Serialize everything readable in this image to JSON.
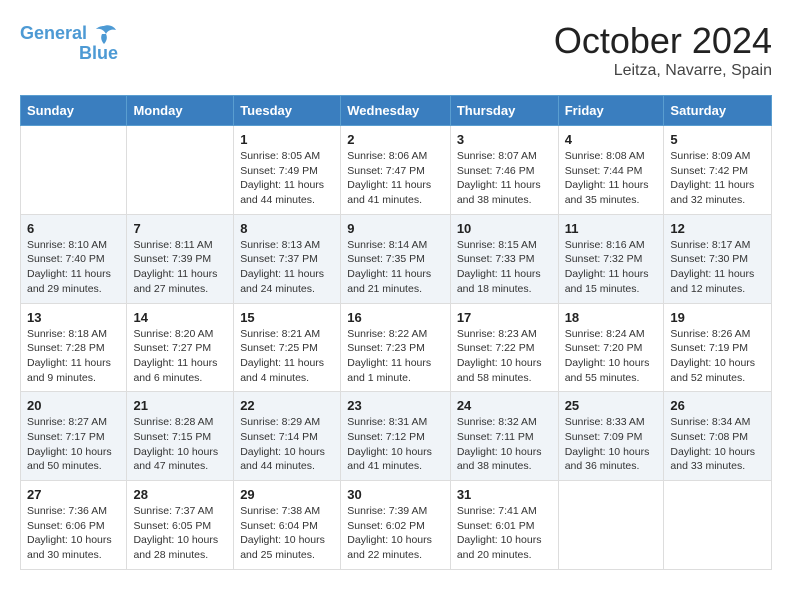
{
  "header": {
    "logo_line1": "General",
    "logo_line2": "Blue",
    "month": "October 2024",
    "location": "Leitza, Navarre, Spain"
  },
  "days_of_week": [
    "Sunday",
    "Monday",
    "Tuesday",
    "Wednesday",
    "Thursday",
    "Friday",
    "Saturday"
  ],
  "weeks": [
    [
      {
        "day": "",
        "info": ""
      },
      {
        "day": "",
        "info": ""
      },
      {
        "day": "1",
        "info": "Sunrise: 8:05 AM\nSunset: 7:49 PM\nDaylight: 11 hours and 44 minutes."
      },
      {
        "day": "2",
        "info": "Sunrise: 8:06 AM\nSunset: 7:47 PM\nDaylight: 11 hours and 41 minutes."
      },
      {
        "day": "3",
        "info": "Sunrise: 8:07 AM\nSunset: 7:46 PM\nDaylight: 11 hours and 38 minutes."
      },
      {
        "day": "4",
        "info": "Sunrise: 8:08 AM\nSunset: 7:44 PM\nDaylight: 11 hours and 35 minutes."
      },
      {
        "day": "5",
        "info": "Sunrise: 8:09 AM\nSunset: 7:42 PM\nDaylight: 11 hours and 32 minutes."
      }
    ],
    [
      {
        "day": "6",
        "info": "Sunrise: 8:10 AM\nSunset: 7:40 PM\nDaylight: 11 hours and 29 minutes."
      },
      {
        "day": "7",
        "info": "Sunrise: 8:11 AM\nSunset: 7:39 PM\nDaylight: 11 hours and 27 minutes."
      },
      {
        "day": "8",
        "info": "Sunrise: 8:13 AM\nSunset: 7:37 PM\nDaylight: 11 hours and 24 minutes."
      },
      {
        "day": "9",
        "info": "Sunrise: 8:14 AM\nSunset: 7:35 PM\nDaylight: 11 hours and 21 minutes."
      },
      {
        "day": "10",
        "info": "Sunrise: 8:15 AM\nSunset: 7:33 PM\nDaylight: 11 hours and 18 minutes."
      },
      {
        "day": "11",
        "info": "Sunrise: 8:16 AM\nSunset: 7:32 PM\nDaylight: 11 hours and 15 minutes."
      },
      {
        "day": "12",
        "info": "Sunrise: 8:17 AM\nSunset: 7:30 PM\nDaylight: 11 hours and 12 minutes."
      }
    ],
    [
      {
        "day": "13",
        "info": "Sunrise: 8:18 AM\nSunset: 7:28 PM\nDaylight: 11 hours and 9 minutes."
      },
      {
        "day": "14",
        "info": "Sunrise: 8:20 AM\nSunset: 7:27 PM\nDaylight: 11 hours and 6 minutes."
      },
      {
        "day": "15",
        "info": "Sunrise: 8:21 AM\nSunset: 7:25 PM\nDaylight: 11 hours and 4 minutes."
      },
      {
        "day": "16",
        "info": "Sunrise: 8:22 AM\nSunset: 7:23 PM\nDaylight: 11 hours and 1 minute."
      },
      {
        "day": "17",
        "info": "Sunrise: 8:23 AM\nSunset: 7:22 PM\nDaylight: 10 hours and 58 minutes."
      },
      {
        "day": "18",
        "info": "Sunrise: 8:24 AM\nSunset: 7:20 PM\nDaylight: 10 hours and 55 minutes."
      },
      {
        "day": "19",
        "info": "Sunrise: 8:26 AM\nSunset: 7:19 PM\nDaylight: 10 hours and 52 minutes."
      }
    ],
    [
      {
        "day": "20",
        "info": "Sunrise: 8:27 AM\nSunset: 7:17 PM\nDaylight: 10 hours and 50 minutes."
      },
      {
        "day": "21",
        "info": "Sunrise: 8:28 AM\nSunset: 7:15 PM\nDaylight: 10 hours and 47 minutes."
      },
      {
        "day": "22",
        "info": "Sunrise: 8:29 AM\nSunset: 7:14 PM\nDaylight: 10 hours and 44 minutes."
      },
      {
        "day": "23",
        "info": "Sunrise: 8:31 AM\nSunset: 7:12 PM\nDaylight: 10 hours and 41 minutes."
      },
      {
        "day": "24",
        "info": "Sunrise: 8:32 AM\nSunset: 7:11 PM\nDaylight: 10 hours and 38 minutes."
      },
      {
        "day": "25",
        "info": "Sunrise: 8:33 AM\nSunset: 7:09 PM\nDaylight: 10 hours and 36 minutes."
      },
      {
        "day": "26",
        "info": "Sunrise: 8:34 AM\nSunset: 7:08 PM\nDaylight: 10 hours and 33 minutes."
      }
    ],
    [
      {
        "day": "27",
        "info": "Sunrise: 7:36 AM\nSunset: 6:06 PM\nDaylight: 10 hours and 30 minutes."
      },
      {
        "day": "28",
        "info": "Sunrise: 7:37 AM\nSunset: 6:05 PM\nDaylight: 10 hours and 28 minutes."
      },
      {
        "day": "29",
        "info": "Sunrise: 7:38 AM\nSunset: 6:04 PM\nDaylight: 10 hours and 25 minutes."
      },
      {
        "day": "30",
        "info": "Sunrise: 7:39 AM\nSunset: 6:02 PM\nDaylight: 10 hours and 22 minutes."
      },
      {
        "day": "31",
        "info": "Sunrise: 7:41 AM\nSunset: 6:01 PM\nDaylight: 10 hours and 20 minutes."
      },
      {
        "day": "",
        "info": ""
      },
      {
        "day": "",
        "info": ""
      }
    ]
  ]
}
